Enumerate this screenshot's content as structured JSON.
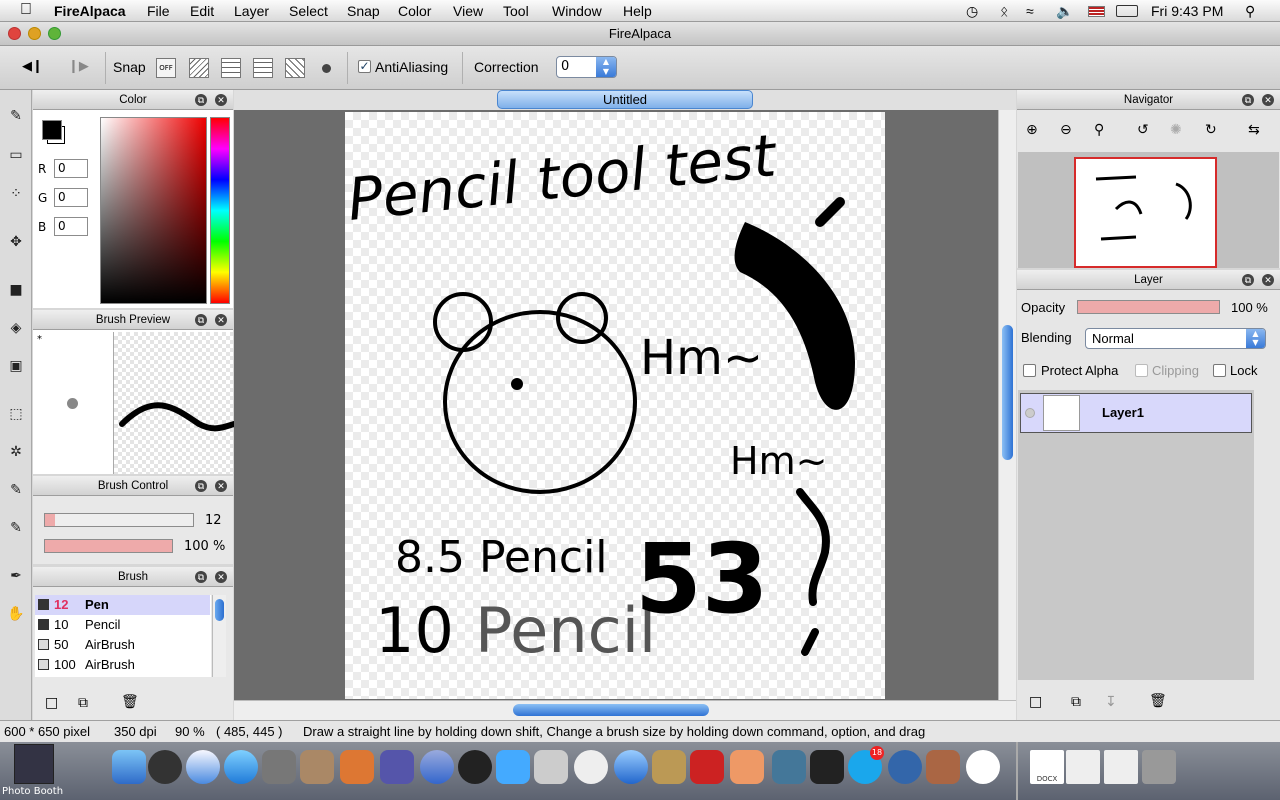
{
  "menubar": {
    "app_name": "FireAlpaca",
    "items": [
      "File",
      "Edit",
      "Layer",
      "Select",
      "Snap",
      "Color",
      "View",
      "Tool",
      "Window",
      "Help"
    ],
    "clock": "Fri 9:43 PM"
  },
  "window": {
    "title": "FireAlpaca"
  },
  "toolbar": {
    "snap_label": "Snap",
    "snap_off_label": "OFF",
    "antialiasing_label": "AntiAliasing",
    "antialiasing_checked": true,
    "correction_label": "Correction",
    "correction_value": "0"
  },
  "color_panel": {
    "title": "Color",
    "r_label": "R",
    "r_value": "0",
    "g_label": "G",
    "g_value": "0",
    "b_label": "B",
    "b_value": "0"
  },
  "brush_preview_panel": {
    "title": "Brush Preview",
    "marker": "*"
  },
  "brush_control_panel": {
    "title": "Brush Control",
    "size_value": "12",
    "opacity_value": "100 %"
  },
  "brush_panel": {
    "title": "Brush",
    "items": [
      {
        "size": "12",
        "name": "Pen",
        "selected": true
      },
      {
        "size": "10",
        "name": "Pencil",
        "selected": false
      },
      {
        "size": "50",
        "name": "AirBrush",
        "selected": false
      },
      {
        "size": "100",
        "name": "AirBrush",
        "selected": false
      }
    ]
  },
  "document": {
    "tab_title": "Untitled",
    "canvas_text": {
      "title": "Pencil tool test",
      "hmm1": "Hm~",
      "hmm2": "Hm~",
      "line1": "8.5 Pencil",
      "line2_num": "10",
      "line2_word": "Pencil",
      "big": "53"
    }
  },
  "navigator_panel": {
    "title": "Navigator"
  },
  "layer_panel": {
    "title": "Layer",
    "opacity_label": "Opacity",
    "opacity_value": "100 %",
    "blending_label": "Blending",
    "blending_value": "Normal",
    "protect_alpha_label": "Protect Alpha",
    "clipping_label": "Clipping",
    "lock_label": "Lock",
    "layers": [
      {
        "name": "Layer1"
      }
    ]
  },
  "statusbar": {
    "size": "600 * 650 pixel",
    "dpi": "350 dpi",
    "zoom": "90 %",
    "coords": "( 485, 445 )",
    "hint": "Draw a straight line by holding down shift, Change a brush size by holding down command, option, and drag"
  },
  "dock": {
    "photobooth_label": "Photo Booth",
    "docs_label": "DOCX",
    "skype_badge": "18"
  },
  "colors": {
    "accent_blue": "#9dc4f0",
    "layer_selected": "#d8d8fb",
    "brush_selected": "#d6d6fa",
    "pink_slider": "#eeaaaa"
  }
}
